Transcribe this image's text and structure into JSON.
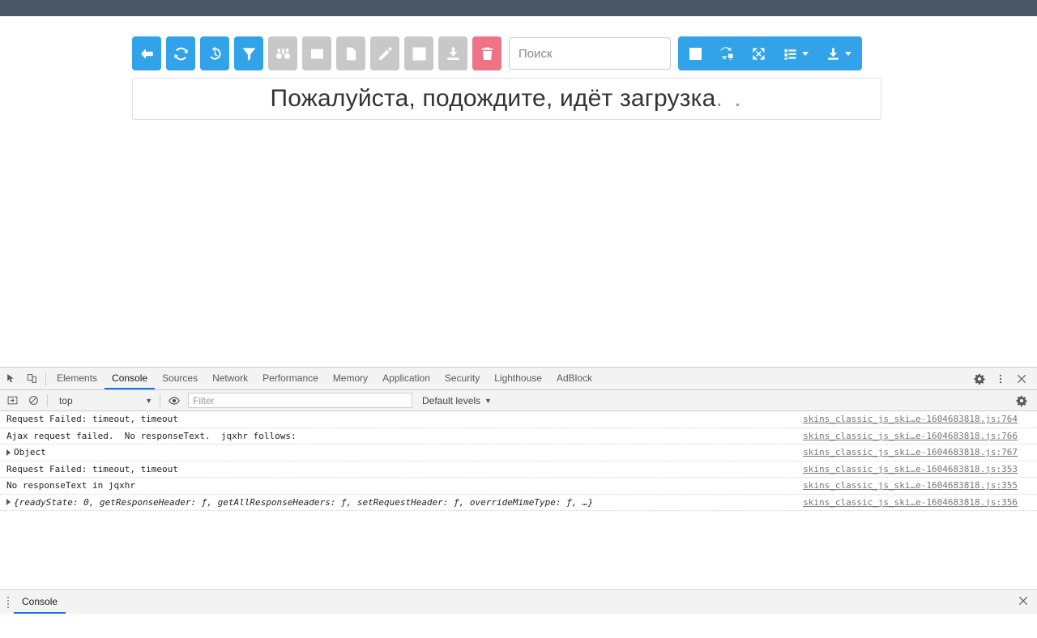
{
  "app": {
    "toolbar": {
      "buttons": [
        {
          "name": "back-button",
          "icon": "arrow-left-icon",
          "style": "blue",
          "label": "Назад"
        },
        {
          "name": "refresh-button",
          "icon": "refresh-icon",
          "style": "blue",
          "label": "Обновить"
        },
        {
          "name": "history-button",
          "icon": "history-icon",
          "style": "blue",
          "label": "История"
        },
        {
          "name": "filter-button",
          "icon": "funnel-icon",
          "style": "blue",
          "label": "Фильтр"
        },
        {
          "name": "find-button",
          "icon": "binoculars-icon",
          "style": "gray",
          "label": "Найти"
        },
        {
          "name": "window-button",
          "icon": "window-icon",
          "style": "gray",
          "label": "Окно"
        },
        {
          "name": "document-button",
          "icon": "document-icon",
          "style": "gray",
          "label": "Документ"
        },
        {
          "name": "edit-button",
          "icon": "pencil-icon",
          "style": "gray",
          "label": "Редактировать"
        },
        {
          "name": "open-external-button",
          "icon": "external-link-icon",
          "style": "gray",
          "label": "Открыть"
        },
        {
          "name": "import-button",
          "icon": "download-box-icon",
          "style": "gray",
          "label": "Импорт"
        },
        {
          "name": "delete-button",
          "icon": "trash-icon",
          "style": "red",
          "label": "Удалить"
        }
      ],
      "search": {
        "value": "",
        "placeholder": "Поиск"
      },
      "right_buttons": [
        {
          "name": "select-all-button",
          "icon": "checkbox-square-icon",
          "caret": false
        },
        {
          "name": "swap-button",
          "icon": "exchange-icon",
          "caret": false
        },
        {
          "name": "fullscreen-button",
          "icon": "expand-arrows-icon",
          "caret": false
        },
        {
          "name": "columns-button",
          "icon": "list-icon",
          "caret": true
        },
        {
          "name": "export-button",
          "icon": "download-icon",
          "caret": true
        }
      ],
      "colors": {
        "primary": "#32a3e8",
        "danger": "#ed7385",
        "disabled": "#c8c8c8"
      }
    },
    "loading": {
      "message": "Пожалуйста, подождите, идёт загрузка",
      "dots": ". ."
    }
  },
  "devtools": {
    "tabs": [
      {
        "label": "Elements",
        "active": false
      },
      {
        "label": "Console",
        "active": true
      },
      {
        "label": "Sources",
        "active": false
      },
      {
        "label": "Network",
        "active": false
      },
      {
        "label": "Performance",
        "active": false
      },
      {
        "label": "Memory",
        "active": false
      },
      {
        "label": "Application",
        "active": false
      },
      {
        "label": "Security",
        "active": false
      },
      {
        "label": "Lighthouse",
        "active": false
      },
      {
        "label": "AdBlock",
        "active": false
      }
    ],
    "tabbar_icons": [
      {
        "name": "inspect-element-icon"
      },
      {
        "name": "device-toolbar-icon"
      }
    ],
    "tabbar_right_icons": [
      {
        "name": "settings-gear-icon"
      },
      {
        "name": "more-options-icon"
      },
      {
        "name": "close-devtools-icon"
      }
    ],
    "filterbar": {
      "sidebar_toggle_icon": "sidebar-toggle-icon",
      "clear_console_icon": "clear-console-icon",
      "context": "top",
      "eye_icon": "live-expression-icon",
      "filter": {
        "value": "",
        "placeholder": "Filter"
      },
      "levels": "Default levels",
      "settings_icon": "console-settings-icon"
    },
    "console": {
      "rows": [
        {
          "expandable": false,
          "italic": false,
          "text": "Request Failed: timeout, timeout",
          "source": "skins_classic_js_ski…e-1604683818.js:764"
        },
        {
          "expandable": false,
          "italic": false,
          "text": "Ajax request failed.  No responseText.  jqxhr follows:",
          "source": "skins_classic_js_ski…e-1604683818.js:766"
        },
        {
          "expandable": true,
          "italic": false,
          "text": "Object",
          "source": "skins_classic_js_ski…e-1604683818.js:767"
        },
        {
          "expandable": false,
          "italic": false,
          "text": "Request Failed: timeout, timeout",
          "source": "skins_classic_js_ski…e-1604683818.js:353"
        },
        {
          "expandable": false,
          "italic": false,
          "text": "No responseText in jqxhr",
          "source": "skins_classic_js_ski…e-1604683818.js:355"
        },
        {
          "expandable": true,
          "italic": true,
          "text": "{readyState: 0, getResponseHeader: ƒ, getAllResponseHeaders: ƒ, setRequestHeader: ƒ, overrideMimeType: ƒ, …}",
          "source": "skins_classic_js_ski…e-1604683818.js:356"
        }
      ]
    },
    "drawer": {
      "tab": "Console",
      "close_icon": "close-drawer-icon"
    }
  }
}
